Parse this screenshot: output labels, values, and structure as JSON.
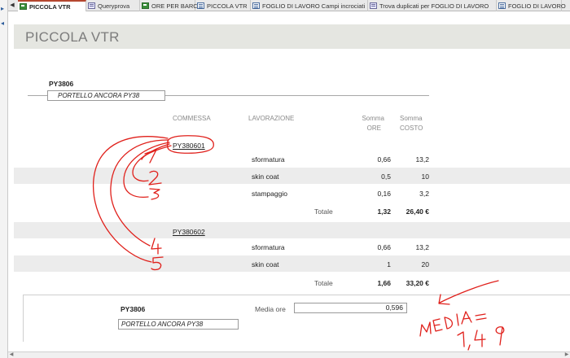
{
  "tabs": [
    {
      "label": "PICCOLA VTR",
      "icon": "report-icon",
      "active": true
    },
    {
      "label": "Queryprova",
      "icon": "query-icon"
    },
    {
      "label": "ORE PER BARCA",
      "icon": "report-icon"
    },
    {
      "label": "PICCOLA VTR",
      "icon": "form-icon"
    },
    {
      "label": "FOGLIO DI LAVORO Campi incrociati",
      "icon": "form-icon"
    },
    {
      "label": "Trova duplicati per FOGLIO DI LAVORO",
      "icon": "query-icon"
    },
    {
      "label": "FOGLIO DI LAVORO",
      "icon": "form-icon"
    }
  ],
  "report": {
    "title": "PICCOLA VTR",
    "group": {
      "code": "PY3806",
      "description": "PORTELLO ANCORA PY38"
    },
    "headers": {
      "commessa": "COMMESSA",
      "lavorazione": "LAVORAZIONE",
      "somma_ore_1": "Somma",
      "somma_ore_2": "ORE",
      "somma_costo_1": "Somma",
      "somma_costo_2": "COSTO"
    },
    "commesse": [
      {
        "code": "PY380601",
        "rows": [
          {
            "lavorazione": "sformatura",
            "ore": "0,66",
            "costo": "13,2"
          },
          {
            "lavorazione": "skin coat",
            "ore": "0,5",
            "costo": "10"
          },
          {
            "lavorazione": "stampaggio",
            "ore": "0,16",
            "costo": "3,2"
          }
        ],
        "totale_label": "Totale",
        "totale_ore": "1,32",
        "totale_costo": "26,40 €"
      },
      {
        "code": "PY380602",
        "rows": [
          {
            "lavorazione": "sformatura",
            "ore": "0,66",
            "costo": "13,2"
          },
          {
            "lavorazione": "skin coat",
            "ore": "1",
            "costo": "20"
          }
        ],
        "totale_label": "Totale",
        "totale_ore": "1,66",
        "totale_costo": "33,20 €"
      }
    ],
    "footer": {
      "code": "PY3806",
      "description": "PORTELLO ANCORA PY38",
      "media_label": "Media ore",
      "media_value": "0,596"
    }
  },
  "annotation": {
    "labels": [
      "1",
      "2",
      "3",
      "4",
      "5"
    ],
    "note_line1": "MEDIA =",
    "note_line2": "1,4 9",
    "color": "#e0201b"
  },
  "colors": {
    "title_band": "#e5e6e1",
    "row_band": "#ececec",
    "active_tab_accent": "#b5472f"
  }
}
